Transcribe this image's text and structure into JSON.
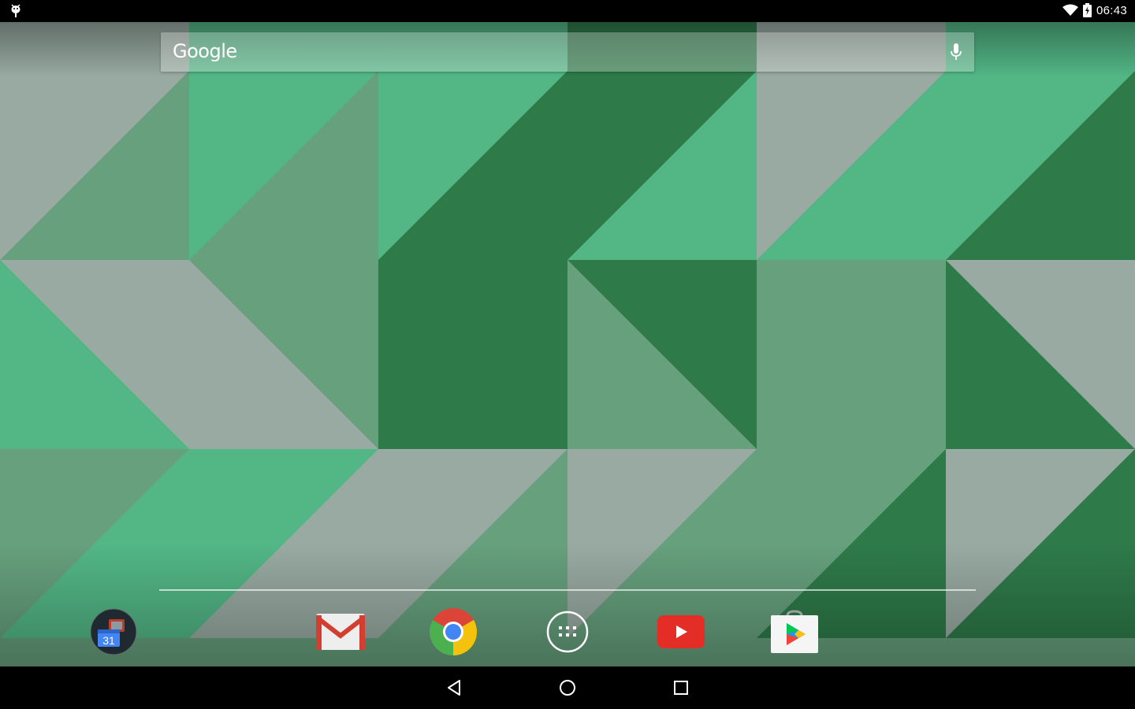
{
  "status_bar": {
    "time": "06:43",
    "notification_icon": "android-debug-icon",
    "wifi_icon": "wifi-icon",
    "battery_icon": "battery-charging-icon"
  },
  "search_widget": {
    "logo_text": "Google",
    "mic_icon": "microphone-icon"
  },
  "dock": {
    "apps": [
      {
        "id": "calendar",
        "icon": "calendar-folder-icon",
        "badge": "31"
      },
      {
        "id": "gmail",
        "icon": "gmail-icon"
      },
      {
        "id": "chrome",
        "icon": "chrome-icon"
      },
      {
        "id": "app-drawer",
        "icon": "app-drawer-icon"
      },
      {
        "id": "youtube",
        "icon": "youtube-icon"
      },
      {
        "id": "play-store",
        "icon": "play-store-icon"
      }
    ]
  },
  "nav_bar": {
    "back_icon": "back-icon",
    "home_icon": "home-icon",
    "recents_icon": "recents-icon"
  },
  "colors": {
    "gray": "#98aaa2",
    "mid_green": "#66a07d",
    "light_green": "#52b685",
    "dark_green": "#2e7a49"
  }
}
